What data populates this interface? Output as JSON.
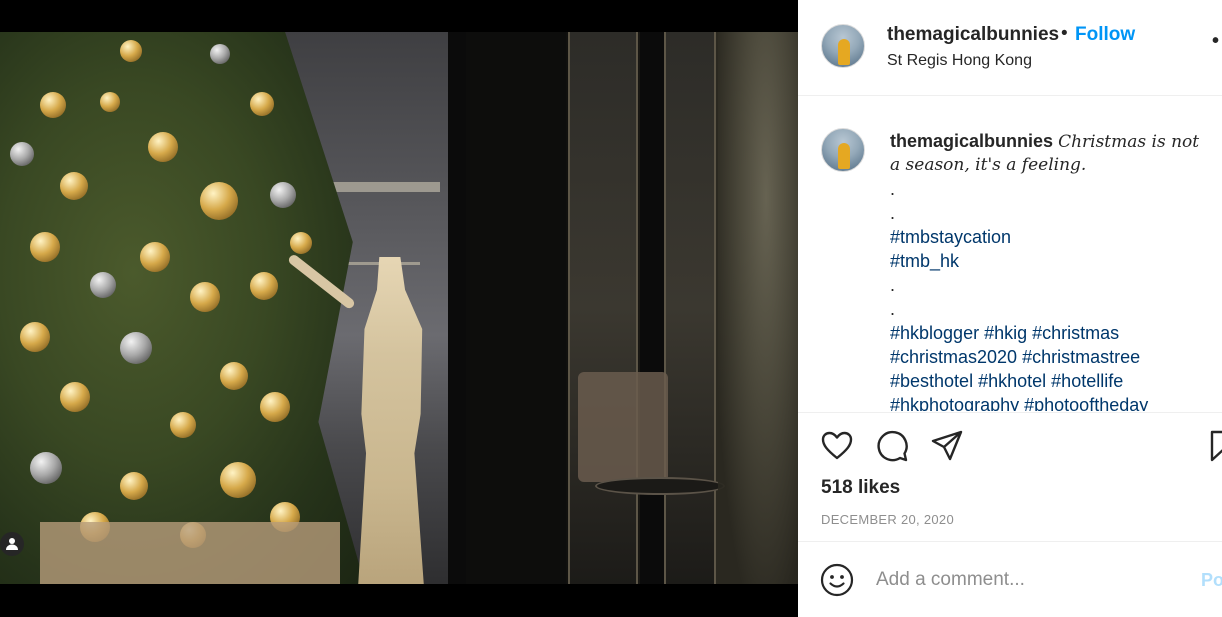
{
  "post": {
    "username": "themagicalbunnies",
    "follow_separator": "•",
    "follow_label": "Follow",
    "location": "St Regis Hong Kong",
    "more_label": "•"
  },
  "caption": {
    "username": "themagicalbunnies",
    "text_line1": "Christmas is not",
    "text_line2": "a season, it's a feeling.",
    "dots": [
      ".",
      ".",
      ".",
      "."
    ],
    "hashtags_group1": [
      "#tmbstaycation",
      "#tmb_hk"
    ],
    "hashtags_line1": [
      "#hkblogger",
      "#hkig",
      "#christmas"
    ],
    "hashtags_line2": [
      "#christmas2020",
      "#christmastree"
    ],
    "hashtags_line3": [
      "#besthotel",
      "#hkhotel",
      "#hotellife"
    ],
    "hashtags_line4_partial": [
      "#hkphotography",
      "#photooftheday"
    ]
  },
  "actions": {
    "like_icon": "heart-icon",
    "comment_icon": "comment-bubble-icon",
    "share_icon": "paper-plane-icon",
    "save_icon": "bookmark-icon"
  },
  "likes_text": "518 likes",
  "date_text": "DECEMBER 20, 2020",
  "comment": {
    "emoji_icon": "smiley-icon",
    "placeholder": "Add a comment...",
    "post_label": "Po"
  },
  "colors": {
    "link": "#0095f6",
    "hashtag": "#00376b",
    "muted": "#8e8e8e",
    "text": "#262626",
    "post_disabled": "#b2dffc"
  }
}
